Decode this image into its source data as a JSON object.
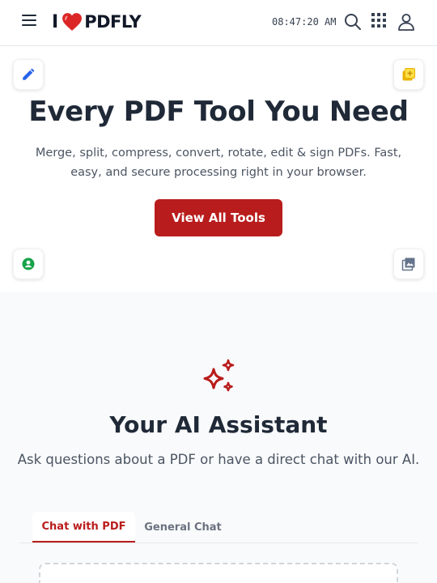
{
  "header": {
    "logo_prefix": "I",
    "logo_word": "PDFLY",
    "clock": "08:47:20 AM",
    "menu_icon": "hamburger-menu-icon",
    "search_icon": "search-icon",
    "apps_icon": "grid-apps-icon",
    "user_icon": "user-icon"
  },
  "hero": {
    "title": "Every PDF Tool You Need",
    "subtitle": "Merge, split, compress, convert, rotate, edit & sign PDFs. Fast, easy, and secure processing right in your browser.",
    "cta_label": "View All Tools"
  },
  "bubbles": [
    {
      "icon": "pencil-icon",
      "color": "#2563eb"
    },
    {
      "icon": "image-add-icon",
      "color": "#eab308"
    },
    {
      "icon": "user-circle-icon",
      "color": "#16a34a"
    },
    {
      "icon": "photo-library-icon",
      "color": "#64748b"
    }
  ],
  "ai": {
    "icon": "sparkles-icon",
    "title": "Your AI Assistant",
    "subtitle": "Ask questions about a PDF or have a direct chat with our AI.",
    "tabs": [
      {
        "label": "Chat with PDF",
        "active": true
      },
      {
        "label": "General Chat",
        "active": false
      }
    ]
  },
  "colors": {
    "brand": "#b91c1c",
    "heart": "#dc2626"
  }
}
